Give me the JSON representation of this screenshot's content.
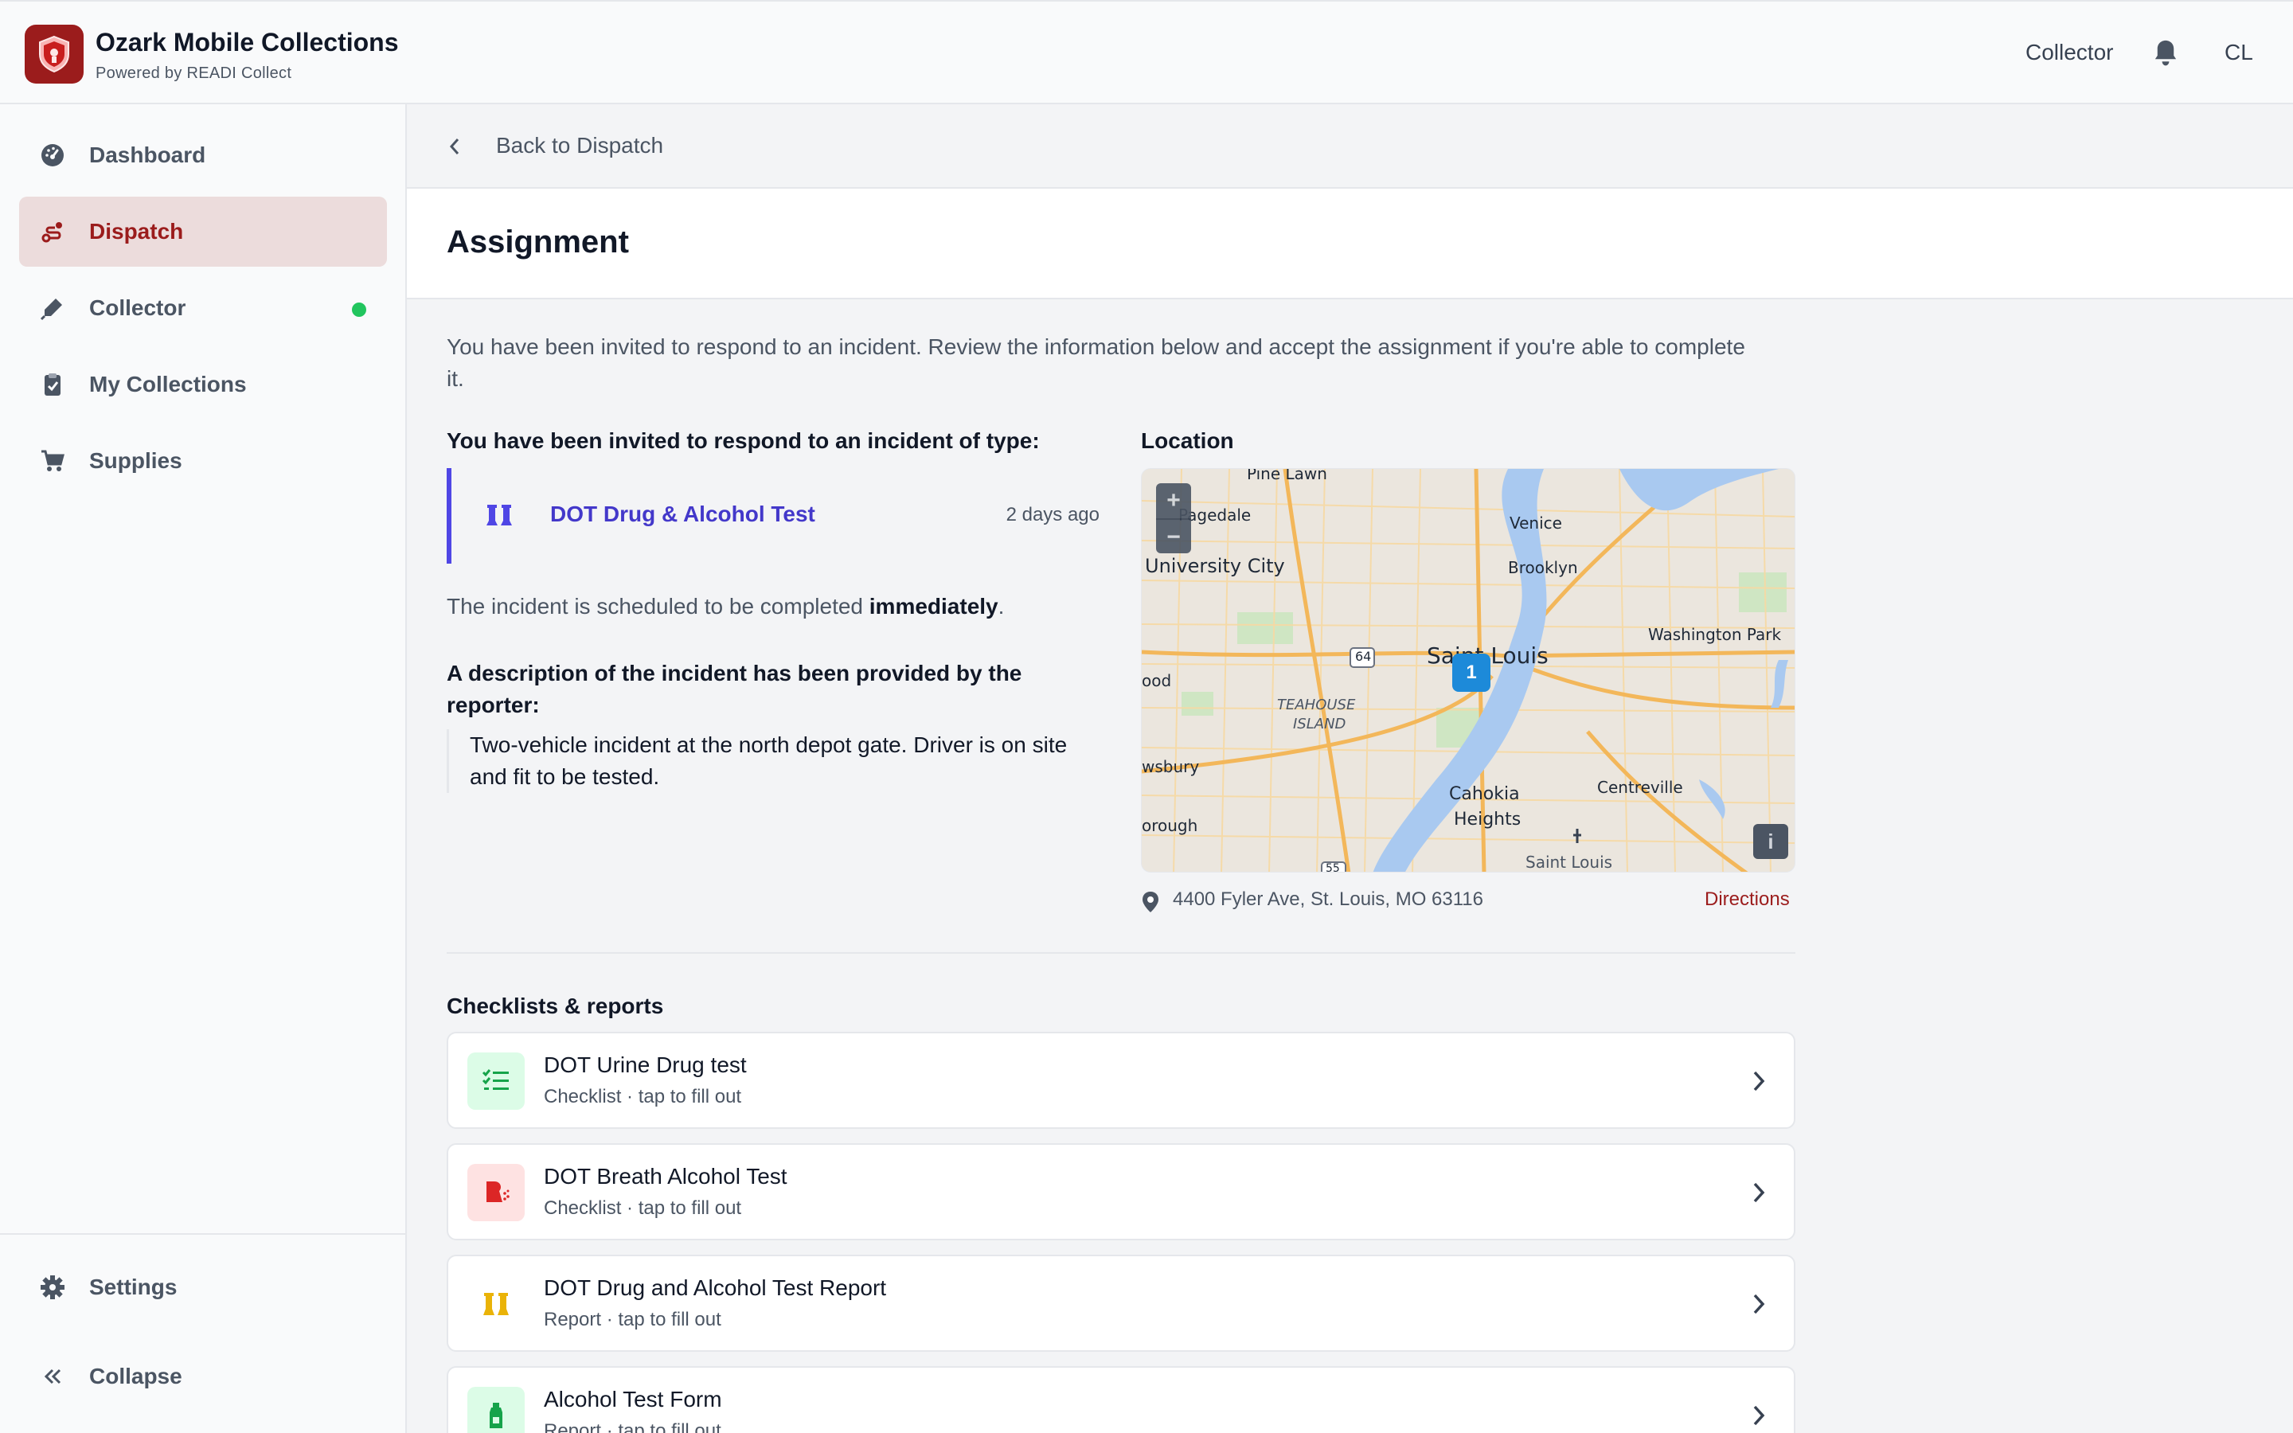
{
  "header": {
    "app_title": "Ozark Mobile Collections",
    "app_subtitle": "Powered by READI Collect",
    "role": "Collector",
    "avatar_initials": "CL",
    "brand_color": "#9b1c1c"
  },
  "sidebar": {
    "items": [
      {
        "label": "Dashboard",
        "icon": "dashboard-icon"
      },
      {
        "label": "Dispatch",
        "icon": "dispatch-icon",
        "active": true
      },
      {
        "label": "Collector",
        "icon": "collector-icon",
        "status": "online"
      },
      {
        "label": "My Collections",
        "icon": "clipboard-icon"
      },
      {
        "label": "Supplies",
        "icon": "cart-icon"
      }
    ],
    "settings_label": "Settings",
    "collapse_label": "Collapse"
  },
  "back": {
    "label": "Back to Dispatch"
  },
  "page": {
    "title": "Assignment"
  },
  "intro": "You have been invited to respond to an incident. Review the information below and accept the assignment if you're able to complete it.",
  "incident": {
    "heading": "You have been invited to respond to an incident of type:",
    "type_label": "DOT Drug & Alcohol Test",
    "time_ago": "2 days ago",
    "schedule_prefix": "The incident is scheduled to be completed ",
    "schedule_emphasis": "immediately",
    "schedule_suffix": ".",
    "description_heading": "A description of the incident has been provided by the reporter:",
    "description": "Two-vehicle incident at the north depot gate. Driver is on site and fit to be tested."
  },
  "location": {
    "heading": "Location",
    "address": "4400 Fyler Ave, St. Louis, MO 63116",
    "directions_label": "Directions",
    "map": {
      "zoom_in": "+",
      "zoom_out": "−",
      "marker_count": "1",
      "info": "i",
      "labels": {
        "pine_lawn": "Pine Lawn",
        "pagedale": "Pagedale",
        "university_city": "University City",
        "venice": "Venice",
        "brooklyn": "Brooklyn",
        "washington_park": "Washington Park",
        "saint_louis": "Saint Louis",
        "ood": "ood",
        "highway_64": "64",
        "teahouse_1": "TEAHOUSE",
        "teahouse_2": "ISLAND",
        "wsbury": "wsbury",
        "cahokia_1": "Cahokia",
        "cahokia_2": "Heights",
        "centreville": "Centreville",
        "orough": "orough",
        "saint_louis_airport": "Saint Louis",
        "highway_55": "55"
      }
    }
  },
  "checklists": {
    "heading": "Checklists & reports",
    "items": [
      {
        "title": "DOT Urine Drug test",
        "subtitle": "Checklist · tap to fill out",
        "icon": "list-check-icon",
        "color": "#16a34a",
        "bg": "#dcfce7"
      },
      {
        "title": "DOT Breath Alcohol Test",
        "subtitle": "Checklist · tap to fill out",
        "icon": "breath-icon",
        "color": "#dc2626",
        "bg": "#fee2e2"
      },
      {
        "title": "DOT Drug and Alcohol Test Report",
        "subtitle": "Report · tap to fill out",
        "icon": "flask-icon",
        "color": "#eab308",
        "bg": "#ffffff"
      },
      {
        "title": "Alcohol Test Form",
        "subtitle": "Report · tap to fill out",
        "icon": "bottle-icon",
        "color": "#16a34a",
        "bg": "#dcfce7"
      }
    ]
  }
}
